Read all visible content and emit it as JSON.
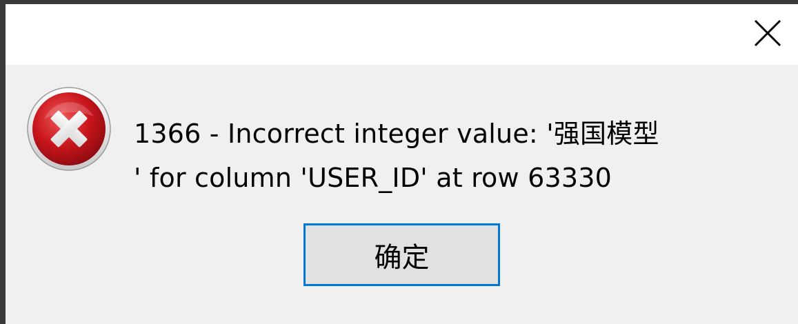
{
  "dialog": {
    "icon": "error-icon",
    "message": "1366 - Incorrect integer value: '强国模型\n' for column 'USER_ID' at row 63330",
    "ok_label": "确定",
    "close_icon": "close-icon"
  },
  "colors": {
    "titlebar": "#ffffff",
    "body": "#f0f0f0",
    "button_face": "#e1e1e1",
    "button_focus_border": "#0078d7",
    "icon_red": "#c4141b"
  }
}
